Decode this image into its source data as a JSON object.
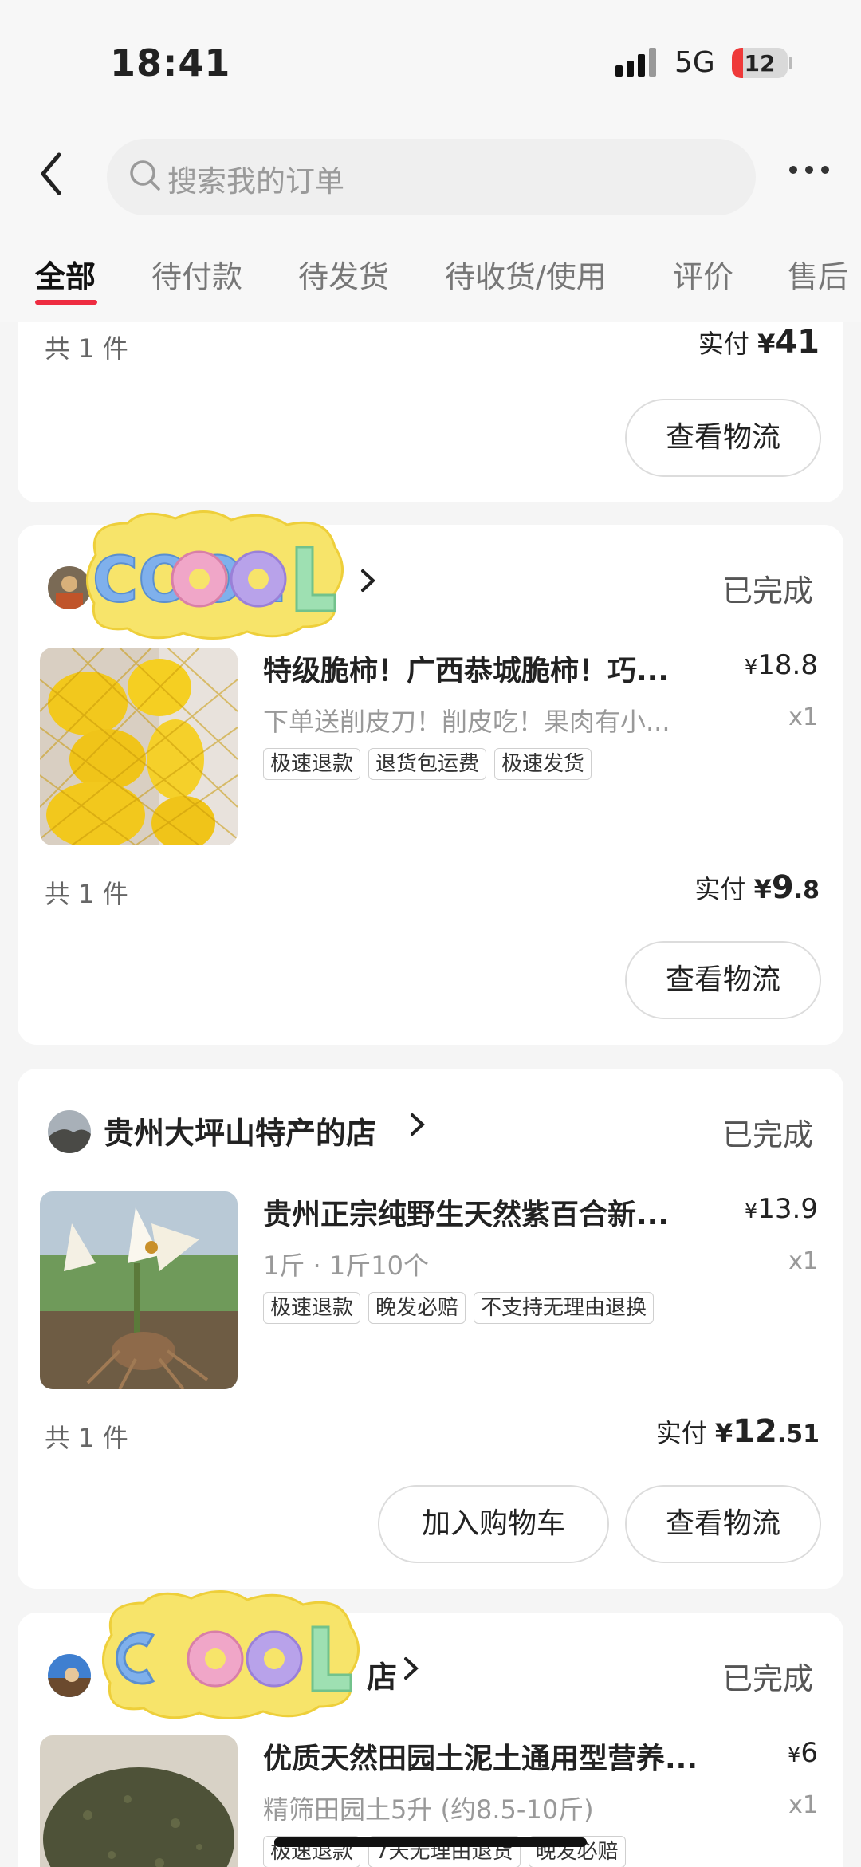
{
  "status_bar": {
    "time": "18:41",
    "network": "5G",
    "battery": "12"
  },
  "search": {
    "placeholder": "搜索我的订单"
  },
  "tabs": [
    {
      "label": "全部",
      "active": true
    },
    {
      "label": "待付款"
    },
    {
      "label": "待发货"
    },
    {
      "label": "待收货/使用"
    },
    {
      "label": "评价"
    },
    {
      "label": "售后"
    }
  ],
  "sticker_text": "COOL",
  "orders": [
    {
      "count": "共 1 件",
      "paid_label": "实付",
      "paid_yen": "¥",
      "paid_int": "41",
      "paid_dec": "",
      "buttons": [
        "查看物流"
      ]
    },
    {
      "shop": "",
      "status": "已完成",
      "title": "特级脆柿！广西恭城脆柿！巧...",
      "price": "18.8",
      "spec": "下单送削皮刀！削皮吃！果肉有小...",
      "qty": "x1",
      "tags": [
        "极速退款",
        "退货包运费",
        "极速发货"
      ],
      "count": "共 1 件",
      "paid_label": "实付",
      "paid_yen": "¥",
      "paid_int": "9",
      "paid_dec": ".8",
      "buttons": [
        "查看物流"
      ]
    },
    {
      "shop": "贵州大坪山特产的店",
      "status": "已完成",
      "title": "贵州正宗纯野生天然紫百合新...",
      "price": "13.9",
      "spec": "1斤 · 1斤10个",
      "qty": "x1",
      "tags": [
        "极速退款",
        "晚发必赔",
        "不支持无理由退换"
      ],
      "count": "共 1 件",
      "paid_label": "实付",
      "paid_yen": "¥",
      "paid_int": "12",
      "paid_dec": ".51",
      "buttons": [
        "加入购物车",
        "查看物流"
      ]
    },
    {
      "shop": "店",
      "status": "已完成",
      "title": "优质天然田园土泥土通用型营养...",
      "price": "6",
      "spec": "精筛田园土5升 (约8.5-10斤)",
      "qty": "x1",
      "tags": [
        "极速退款",
        "7天无理由退货",
        "晚发必赔"
      ]
    }
  ],
  "colors": {
    "accent": "#ee2c41",
    "background": "#f5f5f5",
    "card": "#ffffff"
  }
}
